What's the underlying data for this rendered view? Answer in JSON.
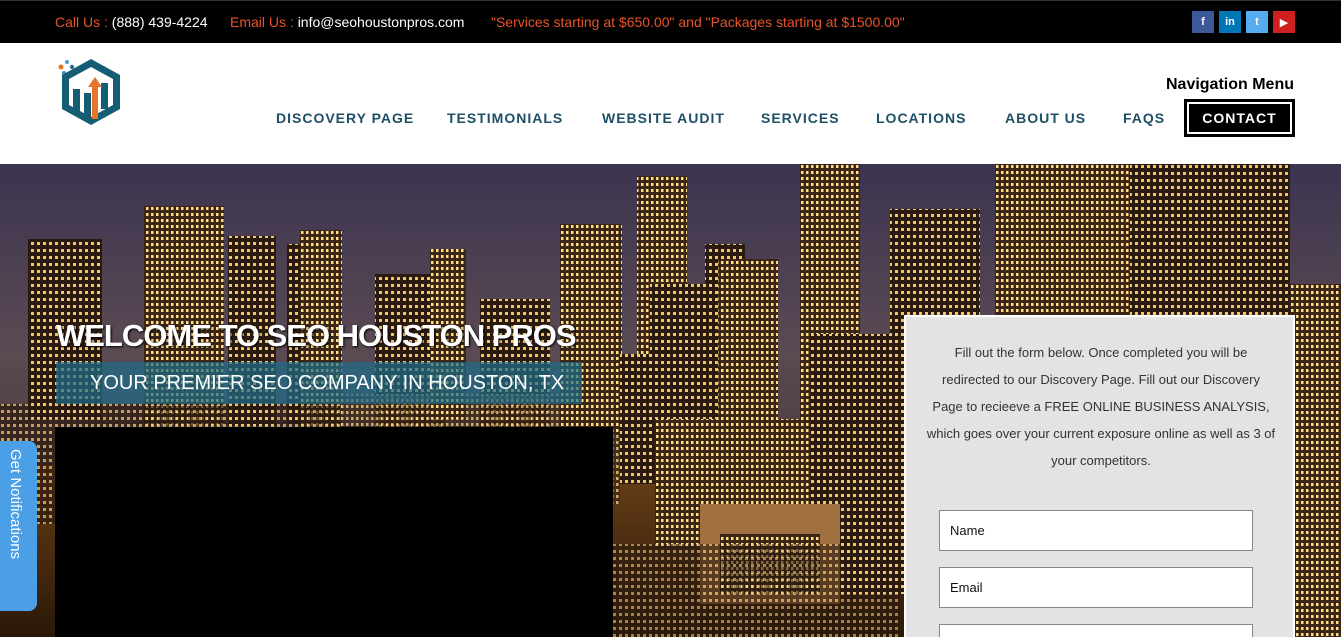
{
  "topbar": {
    "call_label": "Call Us :",
    "call_value": "(888) 439-4224",
    "email_label": "Email Us :",
    "email_value": "info@seohoustonpros.com",
    "promo": "\"Services starting at $650.00\" and \"Packages starting at $1500.00\"",
    "social": [
      {
        "icon": "facebook-icon",
        "glyph": "f",
        "color": "#3b5998"
      },
      {
        "icon": "linkedin-icon",
        "glyph": "in",
        "color": "#0077b5"
      },
      {
        "icon": "twitter-icon",
        "glyph": "t",
        "color": "#55acee"
      },
      {
        "icon": "youtube-icon",
        "glyph": "▶",
        "color": "#cd201f"
      }
    ]
  },
  "header": {
    "nav_title": "Navigation Menu",
    "nav": [
      "DISCOVERY PAGE",
      "TESTIMONIALS",
      "WEBSITE AUDIT",
      "SERVICES",
      "LOCATIONS",
      "ABOUT US",
      "FAQS"
    ],
    "contact": "CONTACT"
  },
  "hero": {
    "welcome": "WELCOME TO SEO HOUSTON PROS",
    "tagline": "YOUR PREMIER SEO COMPANY IN HOUSTON, TX"
  },
  "form": {
    "intro": "Fill out the form below.  Once completed you will be redirected to our Discovery Page.  Fill out our Discovery Page to recieeve a FREE ONLINE BUSINESS ANALYSIS, which goes over your current exposure online as well as 3 of your competitors.",
    "fields": [
      "Name",
      "Email",
      ""
    ]
  },
  "notifications": {
    "label": "Get Notifications"
  }
}
